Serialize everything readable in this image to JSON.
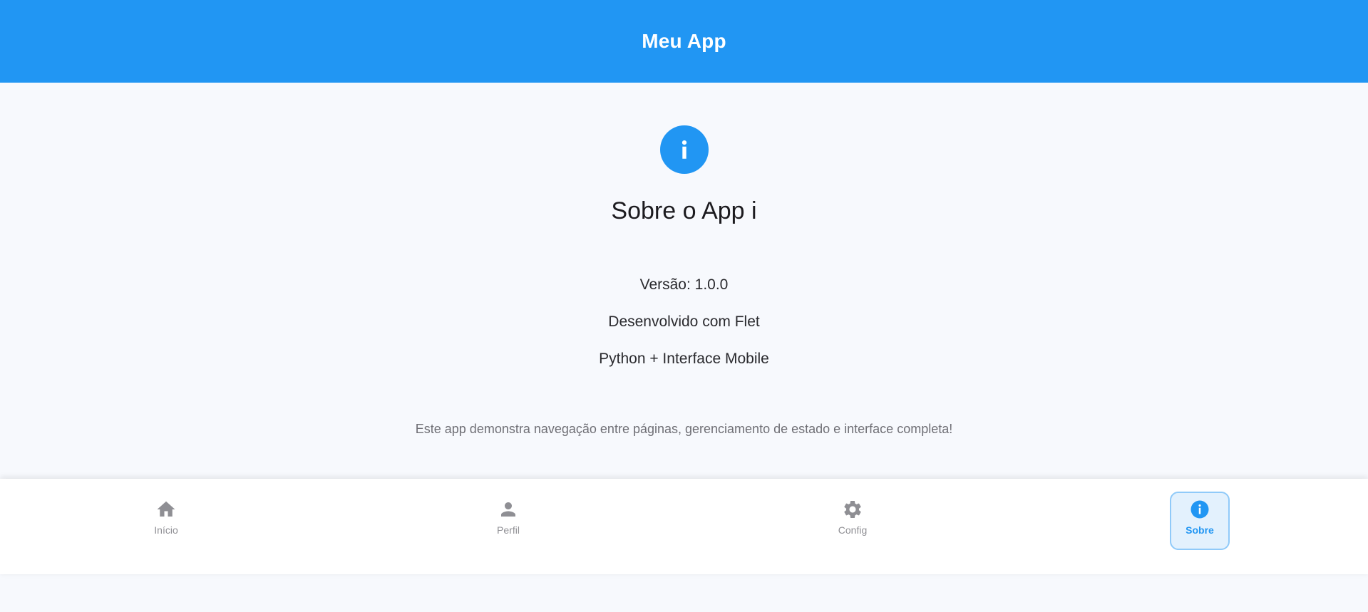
{
  "app_bar": {
    "title": "Meu App"
  },
  "about": {
    "icon": "info-icon",
    "title": "Sobre o App i",
    "version": "Versão: 1.0.0",
    "developed_with": "Desenvolvido com Flet",
    "stack": "Python + Interface Mobile",
    "description": "Este app demonstra navegação entre páginas, gerenciamento de estado e interface completa!"
  },
  "nav": {
    "items": [
      {
        "label": "Início",
        "icon": "home-icon",
        "active": false
      },
      {
        "label": "Perfil",
        "icon": "person-icon",
        "active": false
      },
      {
        "label": "Config",
        "icon": "gear-icon",
        "active": false
      },
      {
        "label": "Sobre",
        "icon": "info-icon",
        "active": true
      }
    ]
  },
  "colors": {
    "primary": "#2196f3",
    "background": "#f7f9fd",
    "nav_active_bg": "#e3f1fd",
    "nav_active_border": "#90caf9",
    "nav_inactive": "#8f8f94"
  }
}
